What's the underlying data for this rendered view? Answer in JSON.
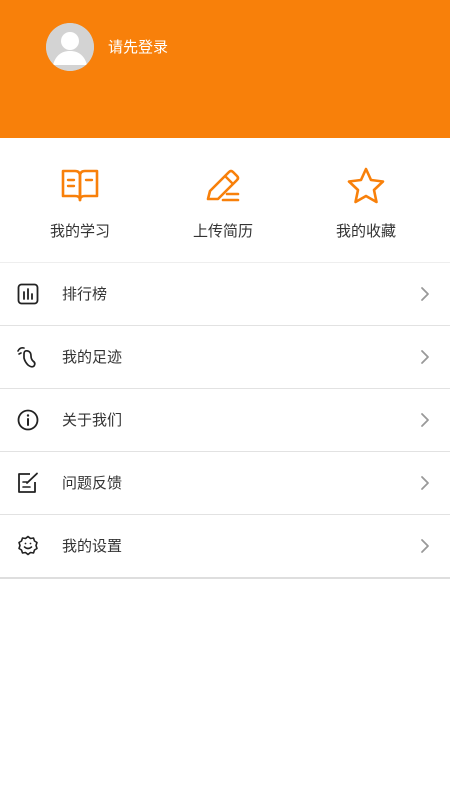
{
  "header": {
    "login_prompt": "请先登录",
    "background_color": "#f8800a",
    "avatar_icon": "default-avatar-icon"
  },
  "quick_actions": [
    {
      "label": "我的学习",
      "icon": "open-book-icon"
    },
    {
      "label": "上传简历",
      "icon": "pencil-edit-icon"
    },
    {
      "label": "我的收藏",
      "icon": "star-icon"
    }
  ],
  "menu": [
    {
      "label": "排行榜",
      "icon": "bar-chart-icon"
    },
    {
      "label": "我的足迹",
      "icon": "footprint-icon"
    },
    {
      "label": "关于我们",
      "icon": "info-icon"
    },
    {
      "label": "问题反馈",
      "icon": "feedback-edit-icon"
    },
    {
      "label": "我的设置",
      "icon": "settings-gear-icon"
    }
  ],
  "colors": {
    "accent": "#f8800a",
    "text": "#333333",
    "chevron": "#999999"
  }
}
